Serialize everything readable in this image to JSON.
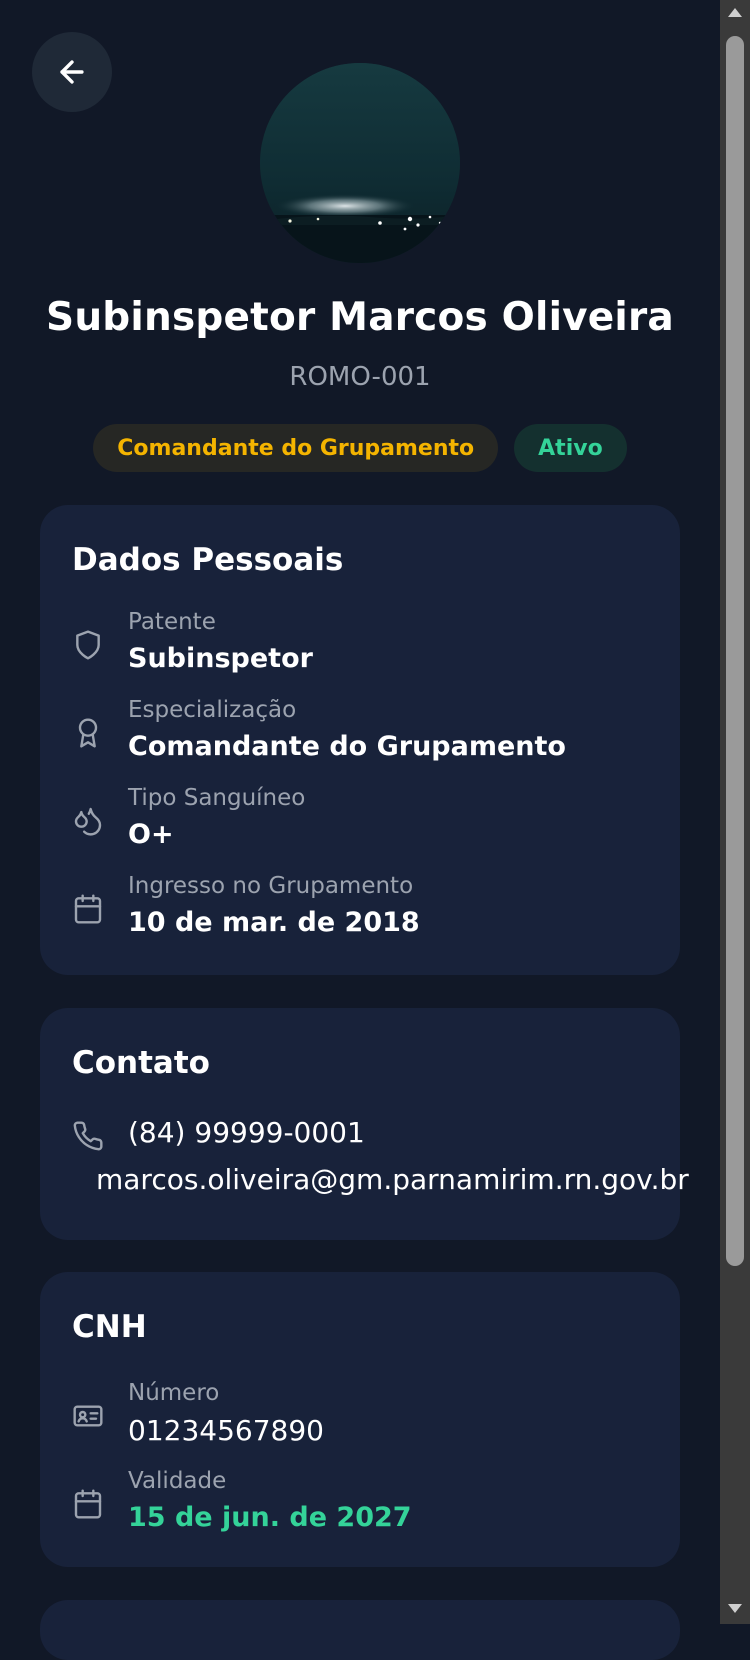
{
  "profile": {
    "name": "Subinspetor Marcos Oliveira",
    "code": "ROMO-001",
    "role_badge": "Comandante do Grupamento",
    "status_badge": "Ativo"
  },
  "personal": {
    "title": "Dados Pessoais",
    "rows": [
      {
        "icon": "shield-icon",
        "label": "Patente",
        "value": "Subinspetor"
      },
      {
        "icon": "award-icon",
        "label": "Especialização",
        "value": "Comandante do Grupamento"
      },
      {
        "icon": "droplets-icon",
        "label": "Tipo Sanguíneo",
        "value": "O+"
      },
      {
        "icon": "calendar-icon",
        "label": "Ingresso no Grupamento",
        "value": "10 de mar. de 2018"
      }
    ]
  },
  "contact": {
    "title": "Contato",
    "phone": "(84) 99999-0001",
    "email": "marcos.oliveira@gm.parnamirim.rn.gov.br"
  },
  "cnh": {
    "title": "CNH",
    "number_label": "Número",
    "number_value": "01234567890",
    "validity_label": "Validade",
    "validity_value": "15 de jun. de 2027"
  },
  "colors": {
    "background": "#111827",
    "card": "#18223a",
    "accent_yellow": "#f4b400",
    "accent_green": "#34d399",
    "muted": "#9ca3af"
  }
}
